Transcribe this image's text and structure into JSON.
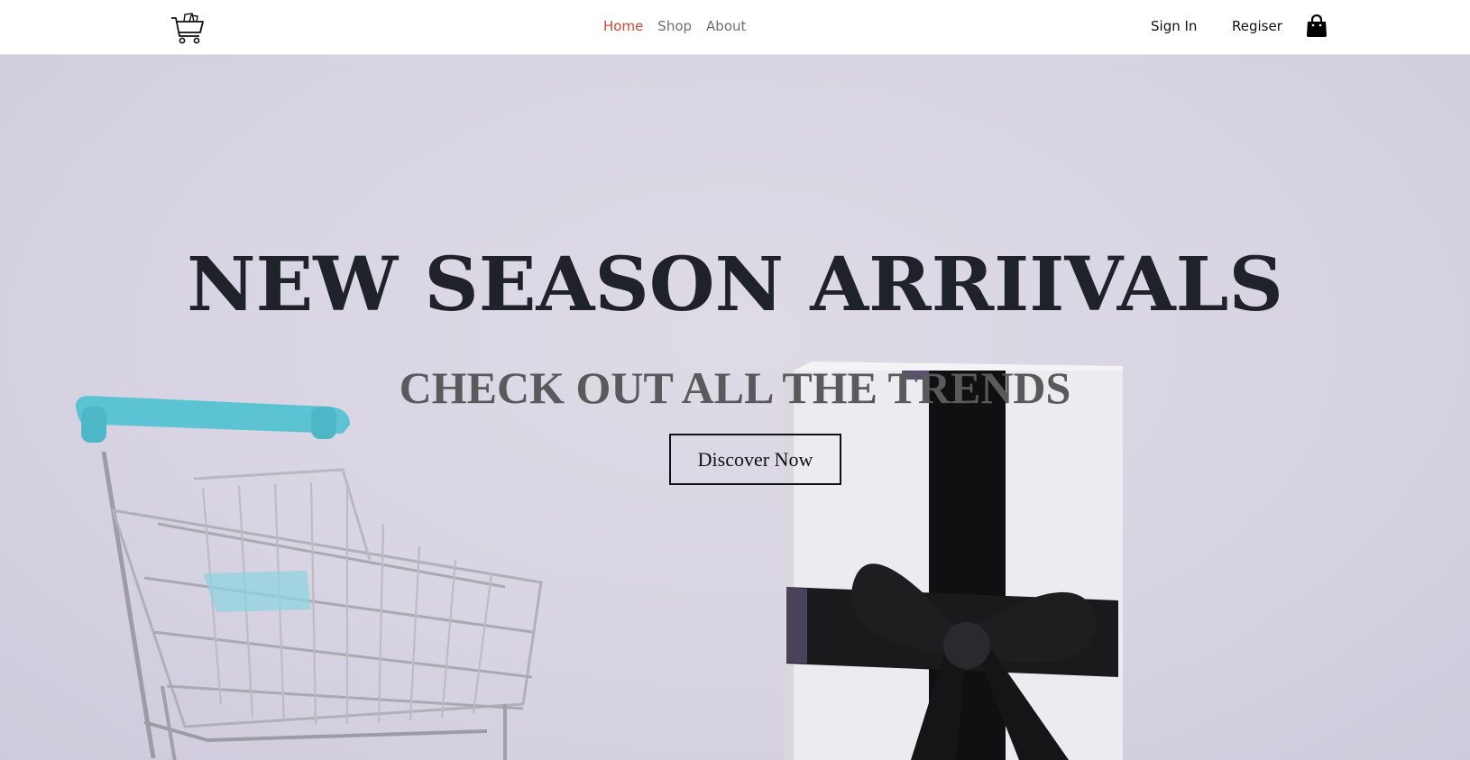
{
  "nav": {
    "links": [
      {
        "label": "Home",
        "active": true
      },
      {
        "label": "Shop",
        "active": false
      },
      {
        "label": "About",
        "active": false
      }
    ],
    "sign_in": "Sign In",
    "register": "Regiser",
    "active_color": "#d9453a",
    "logo_icon": "shopping-cart-icon",
    "bag_icon": "shopping-bag-icon"
  },
  "hero": {
    "title": "NEW SEASON ARRIIVALS",
    "subtitle": "CHECK OUT ALL THE TRENDS",
    "cta": "Discover Now",
    "background_color": "#dad6e4",
    "image_items": [
      "shopping-cart",
      "gift-box-with-black-ribbon"
    ]
  }
}
